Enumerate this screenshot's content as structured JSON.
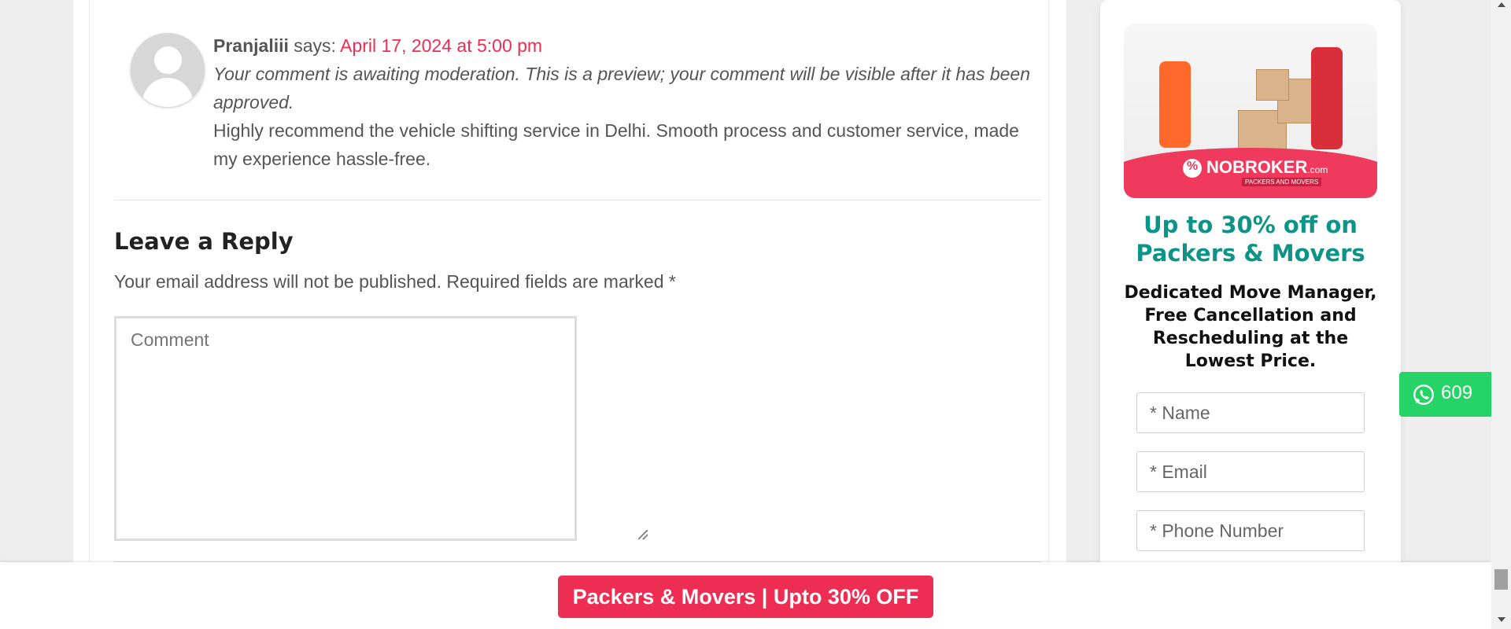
{
  "comment": {
    "author": "Pranjaliii",
    "says": "says:",
    "date": "April 17, 2024 at 5:00 pm",
    "moderation_notice": "Your comment is awaiting moderation. This is a preview; your comment will be visible after it has been approved.",
    "text": "Highly recommend the vehicle shifting service in Delhi. Smooth process and customer service, made my experience hassle-free."
  },
  "reply_form": {
    "title": "Leave a Reply",
    "notes": "Your email address will not be published. Required fields are marked *",
    "comment_placeholder": "Comment"
  },
  "sidebar": {
    "image": {
      "brand": "NOBROKER",
      "brand_suffix": ".com",
      "brand_sub": "PACKERS AND MOVERS"
    },
    "heading": "Up to 30% off on Packers & Movers",
    "subheading": "Dedicated Move Manager, Free Cancellation and Rescheduling at the Lowest Price.",
    "fields": {
      "name_placeholder": "* Name",
      "email_placeholder": "* Email",
      "phone_placeholder": "* Phone Number"
    },
    "accent_color": "#0d9488"
  },
  "whatsapp": {
    "icon": "whatsapp-icon",
    "count": "609",
    "color": "#25d366"
  },
  "bottom_bar": {
    "cta_label": "Packers & Movers | Upto 30% OFF",
    "cta_color": "#ee2d53"
  }
}
